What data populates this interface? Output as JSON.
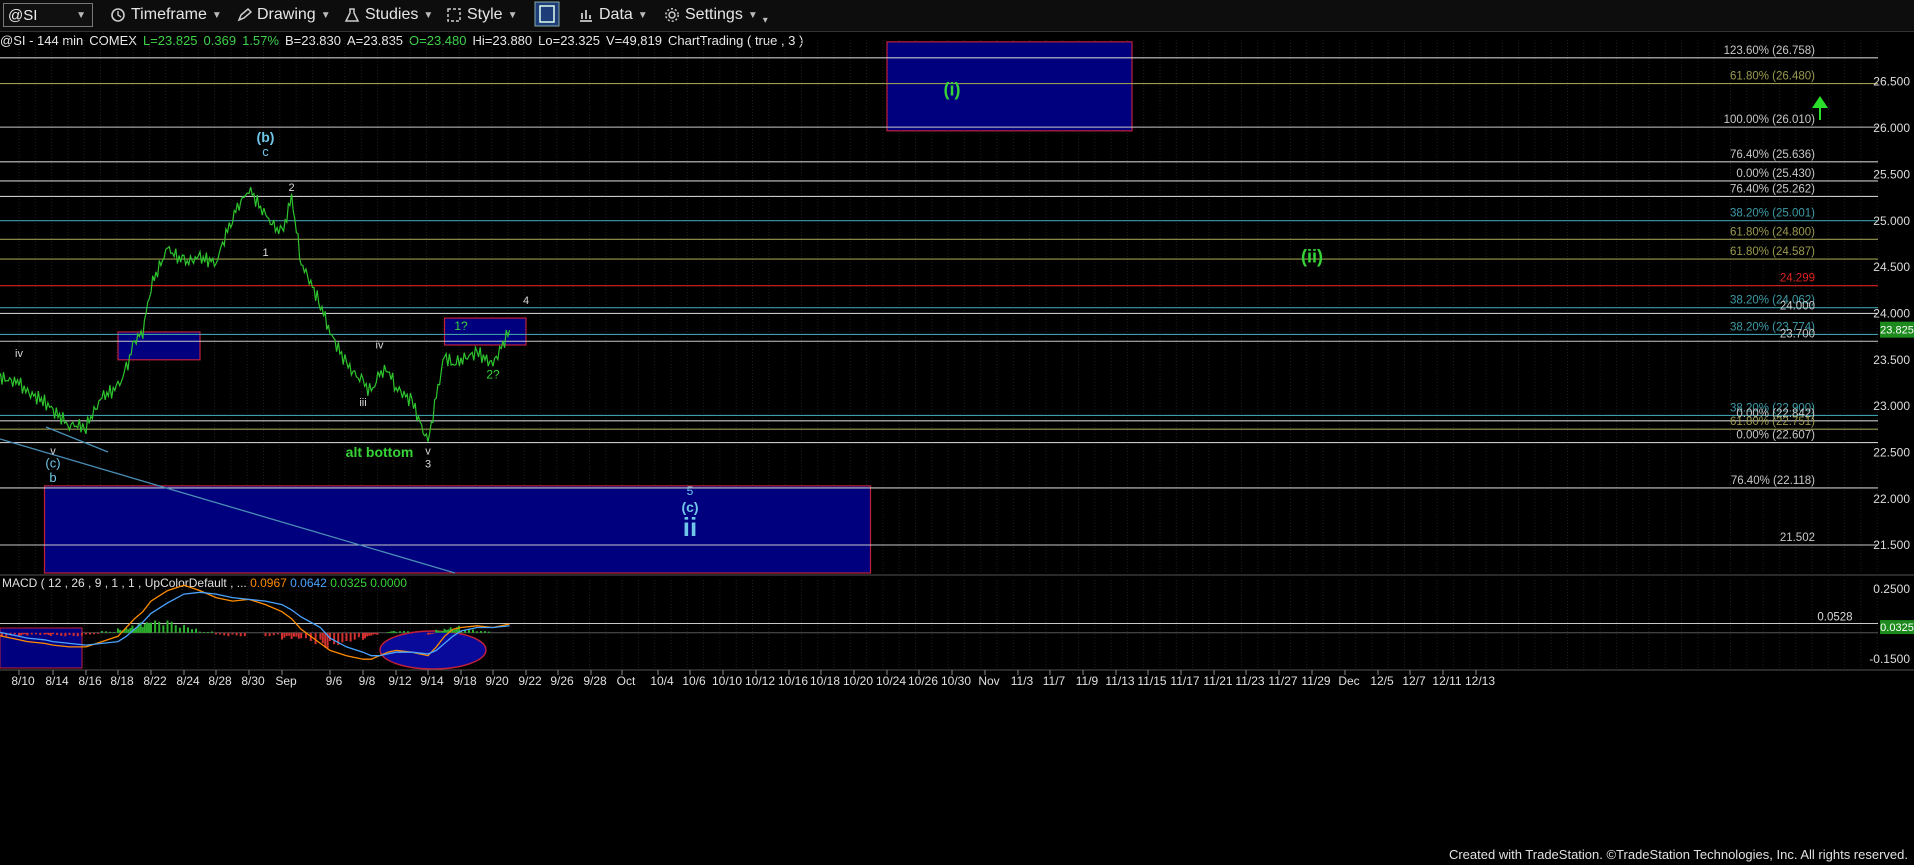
{
  "toolbar": {
    "symbol": "@SI",
    "timeframe": "Timeframe",
    "drawing": "Drawing",
    "studies": "Studies",
    "style": "Style",
    "data": "Data",
    "settings": "Settings"
  },
  "quote": {
    "name": "@SI - 144 min",
    "exchange": "COMEX",
    "last": "L=23.825",
    "change": "0.369",
    "pct": "1.57%",
    "bid": "B=23.830",
    "ask": "A=23.835",
    "open": "O=23.480",
    "high": "Hi=23.880",
    "low": "Lo=23.325",
    "volume": "V=49,819",
    "study": "ChartTrading ( true , 3 )"
  },
  "colors": {
    "box_fill": "#00007e",
    "box_border": "#c0203a",
    "price": "#2ec42e",
    "macd": "#ff8c00",
    "signal": "#4aa3ff",
    "wave_cyan": "#6fc6e8",
    "wave_green": "#36d336"
  },
  "price_axis": [
    "26.500",
    "26.000",
    "25.500",
    "25.000",
    "24.500",
    "24.000",
    "23.500",
    "23.000",
    "22.500",
    "22.000",
    "21.500"
  ],
  "last_price_tag": "23.825",
  "fib_levels": [
    {
      "label": "123.60% (26.758)",
      "value": 26.758,
      "color": "#c8c8c8"
    },
    {
      "label": "61.80% (26.480)",
      "value": 26.48,
      "color": "#9a9a50"
    },
    {
      "label": "100.00% (26.010)",
      "value": 26.01,
      "color": "#c8c8c8"
    },
    {
      "label": "76.40% (25.636)",
      "value": 25.636,
      "color": "#c8c8c8"
    },
    {
      "label": "0.00% (25.430)",
      "value": 25.43,
      "color": "#c8c8c8"
    },
    {
      "label": "76.40% (25.262)",
      "value": 25.262,
      "color": "#c8c8c8"
    },
    {
      "label": "38.20% (25.001)",
      "value": 25.001,
      "color": "#3d9ca8"
    },
    {
      "label": "61.80% (24.800)",
      "value": 24.8,
      "color": "#9a9a50"
    },
    {
      "label": "61.80% (24.587)",
      "value": 24.587,
      "color": "#9a9a50"
    },
    {
      "label": "24.299",
      "value": 24.299,
      "color": "#e02020"
    },
    {
      "label": "38.20% (24.062)",
      "value": 24.062,
      "color": "#3d9ca8"
    },
    {
      "label": "24.000",
      "value": 24.0,
      "color": "#c8c8c8"
    },
    {
      "label": "38.20% (23.774)",
      "value": 23.774,
      "color": "#3d9ca8"
    },
    {
      "label": "23.700",
      "value": 23.7,
      "color": "#c8c8c8"
    },
    {
      "label": "38.20% (22.900)",
      "value": 22.9,
      "color": "#3d9ca8"
    },
    {
      "label": "0.00% (22.842)",
      "value": 22.842,
      "color": "#c8c8c8"
    },
    {
      "label": "61.80% (22.751)",
      "value": 22.751,
      "color": "#9a9a50"
    },
    {
      "label": "0.00% (22.607)",
      "value": 22.607,
      "color": "#c8c8c8"
    },
    {
      "label": "76.40% (22.118)",
      "value": 22.118,
      "color": "#c8c8c8"
    },
    {
      "label": "21.502",
      "value": 21.502,
      "color": "#c8c8c8"
    }
  ],
  "wave_labels": [
    {
      "text": "(b)",
      "date": "8/31",
      "price": 25.85,
      "color": "#6fc6e8",
      "size": 14
    },
    {
      "text": "c",
      "date": "8/31",
      "price": 25.7,
      "color": "#6fc6e8",
      "size": 13
    },
    {
      "text": "2",
      "date": "9/2",
      "price": 25.32,
      "color": "#d8d8d8",
      "size": 11
    },
    {
      "text": "1",
      "date": "8/31",
      "price": 24.62,
      "color": "#d8d8d8",
      "size": 11
    },
    {
      "text": "iv",
      "date": "8/10",
      "price": 23.53,
      "color": "#d8d8d8",
      "size": 11
    },
    {
      "text": "iv",
      "date": "9/10",
      "price": 23.62,
      "color": "#d8d8d8",
      "size": 11
    },
    {
      "text": "iii",
      "date": "9/8",
      "price": 23.0,
      "color": "#d8d8d8",
      "size": 11
    },
    {
      "text": "v",
      "date": "9/14",
      "price": 22.48,
      "color": "#d8d8d8",
      "size": 11
    },
    {
      "text": "3",
      "date": "9/14",
      "price": 22.34,
      "color": "#d8d8d8",
      "size": 11
    },
    {
      "text": "v",
      "date": "8/14",
      "price": 22.48,
      "color": "#d8d8d8",
      "size": 11
    },
    {
      "text": "(c)",
      "date": "8/14",
      "price": 22.34,
      "color": "#6fc6e8",
      "size": 13
    },
    {
      "text": "b",
      "date": "8/14",
      "price": 22.18,
      "color": "#6fc6e8",
      "size": 13
    },
    {
      "text": "4",
      "date": "9/22",
      "price": 24.1,
      "color": "#d8d8d8",
      "size": 11
    },
    {
      "text": "1?",
      "date": "9/18",
      "price": 23.82,
      "color": "#36d336",
      "size": 12
    },
    {
      "text": "2?",
      "date": "9/20",
      "price": 23.3,
      "color": "#36d336",
      "size": 12
    },
    {
      "text": "alt bottom",
      "date": "9/10",
      "price": 22.45,
      "color": "#36d336",
      "size": 14
    },
    {
      "text": "5",
      "date": "10/6",
      "price": 22.04,
      "color": "#6fc6e8",
      "size": 12
    },
    {
      "text": "(c)",
      "date": "10/6",
      "price": 21.86,
      "color": "#6fc6e8",
      "size": 14
    },
    {
      "text": "ii",
      "date": "10/6",
      "price": 21.6,
      "color": "#6fc6e8",
      "size": 26
    },
    {
      "text": "(i)",
      "date": "10/30",
      "price": 26.35,
      "color": "#36d336",
      "size": 18
    },
    {
      "text": "(ii)",
      "date": "11/29",
      "price": 24.55,
      "color": "#36d336",
      "size": 18
    }
  ],
  "boxes": [
    {
      "from": "10/24",
      "to": "11/14",
      "top": 26.93,
      "bottom": 25.97
    },
    {
      "from": "8/18",
      "to": "8/26",
      "top": 23.8,
      "bottom": 23.5
    },
    {
      "from": "9/16",
      "to": "9/22",
      "top": 23.95,
      "bottom": 23.66
    },
    {
      "from": "8/13",
      "to": "10/22",
      "top": 22.14,
      "bottom": 21.2
    }
  ],
  "x_axis": [
    "8/10",
    "8/14",
    "8/16",
    "8/18",
    "8/22",
    "8/24",
    "8/28",
    "8/30",
    "Sep",
    "9/6",
    "9/8",
    "9/12",
    "9/14",
    "9/18",
    "9/20",
    "9/22",
    "9/26",
    "9/28",
    "Oct",
    "10/4",
    "10/6",
    "10/10",
    "10/12",
    "10/16",
    "10/18",
    "10/20",
    "10/24",
    "10/26",
    "10/30",
    "Nov",
    "11/3",
    "11/7",
    "11/9",
    "11/13",
    "11/15",
    "11/17",
    "11/21",
    "11/23",
    "11/27",
    "11/29",
    "Dec",
    "12/5",
    "12/7",
    "12/11",
    "12/13"
  ],
  "macd": {
    "title": "MACD ( 12 , 26 , 9 , 1 , 1 , UpColorDefault , ...",
    "macd_value": "0.0967",
    "signal_value": "0.0642",
    "hist_value": "0.0325",
    "zero_value": "0.0000",
    "axis": [
      "0.2500",
      "-0.1500"
    ],
    "ref_line": "0.0528",
    "tag": "0.0325"
  },
  "chart_data": {
    "type": "line",
    "title": "@SI - 144 min",
    "ylim": [
      21.2,
      26.95
    ],
    "x": [
      "8/6",
      "8/8",
      "8/10",
      "8/11",
      "8/13",
      "8/14",
      "8/15",
      "8/16",
      "8/17",
      "8/18",
      "8/19",
      "8/20",
      "8/21",
      "8/22",
      "8/23",
      "8/24",
      "8/26",
      "8/28",
      "8/29",
      "8/30",
      "8/31",
      "9/1",
      "9/2",
      "9/3",
      "9/5",
      "9/6",
      "9/7",
      "9/8",
      "9/9",
      "9/10",
      "9/11",
      "9/12",
      "9/13",
      "9/14",
      "9/15",
      "9/16",
      "9/17",
      "9/18",
      "9/19",
      "9/20",
      "9/21"
    ],
    "series": [
      {
        "values": [
          23.4,
          23.3,
          23.25,
          23.15,
          23.05,
          22.95,
          22.8,
          22.78,
          23.1,
          23.2,
          23.4,
          23.7,
          23.8,
          24.3,
          24.7,
          24.55,
          24.6,
          24.55,
          25.05,
          25.35,
          25.05,
          24.85,
          25.25,
          24.55,
          24.1,
          23.8,
          23.45,
          23.25,
          23.15,
          23.35,
          23.4,
          23.2,
          23.05,
          22.6,
          23.1,
          23.55,
          23.45,
          23.5,
          23.58,
          23.45,
          23.82
        ]
      }
    ]
  }
}
